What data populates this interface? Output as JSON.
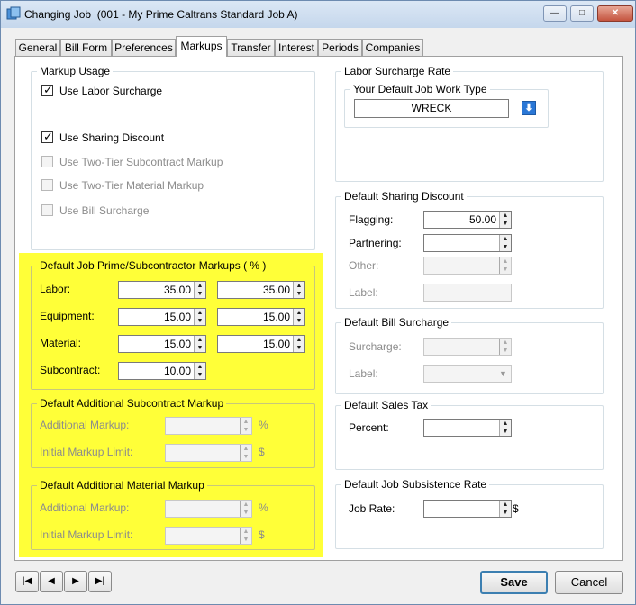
{
  "window": {
    "title": "Changing Job  (001 - My Prime Caltrans Standard Job A)",
    "controls": {
      "minimize": "—",
      "maximize": "□",
      "close": "✕"
    }
  },
  "tabs": [
    {
      "label": "General"
    },
    {
      "label": "Bill Form"
    },
    {
      "label": "Preferences"
    },
    {
      "label": "Markups",
      "active": true
    },
    {
      "label": "Transfer"
    },
    {
      "label": "Interest"
    },
    {
      "label": "Periods"
    },
    {
      "label": "Companies"
    }
  ],
  "markup_usage": {
    "title": "Markup Usage",
    "items": [
      {
        "label": "Use Labor Surcharge",
        "checked": true,
        "enabled": true
      },
      {
        "label": "Use Sharing Discount",
        "checked": true,
        "enabled": true
      },
      {
        "label": "Use Two-Tier Subcontract Markup",
        "checked": false,
        "enabled": false
      },
      {
        "label": "Use Two-Tier Material Markup",
        "checked": false,
        "enabled": false
      },
      {
        "label": "Use Bill Surcharge",
        "checked": false,
        "enabled": false
      }
    ]
  },
  "prime_sub_markups": {
    "title": "Default Job Prime/Subcontractor Markups ( % )",
    "rows": [
      {
        "label": "Labor:",
        "prime": "35.00",
        "sub": "35.00"
      },
      {
        "label": "Equipment:",
        "prime": "15.00",
        "sub": "15.00"
      },
      {
        "label": "Material:",
        "prime": "15.00",
        "sub": "15.00"
      },
      {
        "label": "Subcontract:",
        "prime": "10.00"
      }
    ]
  },
  "additional_sub_markup": {
    "title": "Default Additional Subcontract Markup",
    "additional_label": "Additional Markup:",
    "additional_unit": "%",
    "limit_label": "Initial Markup Limit:",
    "limit_unit": "$"
  },
  "additional_material_markup": {
    "title": "Default Additional Material Markup",
    "additional_label": "Additional Markup:",
    "additional_unit": "%",
    "limit_label": "Initial Markup Limit:",
    "limit_unit": "$"
  },
  "labor_surcharge": {
    "title": "Labor Surcharge Rate",
    "subgroup_title": "Your Default Job Work Type",
    "work_type": "WRECK"
  },
  "sharing_discount": {
    "title": "Default Sharing Discount",
    "flagging_label": "Flagging:",
    "flagging_value": "50.00",
    "partnering_label": "Partnering:",
    "other_label": "Other:",
    "label_label": "Label:"
  },
  "bill_surcharge": {
    "title": "Default Bill Surcharge",
    "surcharge_label": "Surcharge:",
    "label_label": "Label:"
  },
  "sales_tax": {
    "title": "Default Sales Tax",
    "percent_label": "Percent:"
  },
  "subsistence": {
    "title": "Default Job Subsistence Rate",
    "rate_label": "Job Rate:",
    "unit": "$"
  },
  "footer": {
    "nav": [
      "|◀",
      "◀",
      "▶",
      "▶|"
    ],
    "save": "Save",
    "cancel": "Cancel"
  }
}
